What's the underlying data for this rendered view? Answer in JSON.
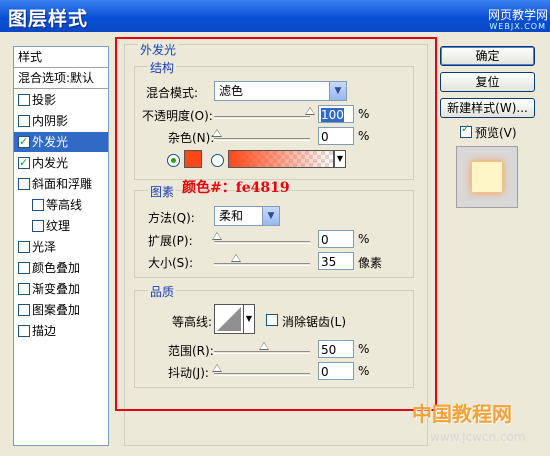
{
  "window": {
    "title": "图层样式",
    "watermark_top": "网页教学网",
    "watermark_url": "WEBJX.COM"
  },
  "styles_panel": {
    "header": "样式",
    "items": [
      {
        "label": "混合选项:默认",
        "checkbox": false,
        "checked": false,
        "selected": false
      },
      {
        "label": "投影",
        "checkbox": true,
        "checked": false,
        "selected": false
      },
      {
        "label": "内阴影",
        "checkbox": true,
        "checked": false,
        "selected": false
      },
      {
        "label": "外发光",
        "checkbox": true,
        "checked": true,
        "selected": true
      },
      {
        "label": "内发光",
        "checkbox": true,
        "checked": true,
        "selected": false
      },
      {
        "label": "斜面和浮雕",
        "checkbox": true,
        "checked": false,
        "selected": false
      },
      {
        "label": "等高线",
        "checkbox": true,
        "checked": false,
        "selected": false
      },
      {
        "label": "纹理",
        "checkbox": true,
        "checked": false,
        "selected": false
      },
      {
        "label": "光泽",
        "checkbox": true,
        "checked": false,
        "selected": false
      },
      {
        "label": "颜色叠加",
        "checkbox": true,
        "checked": false,
        "selected": false
      },
      {
        "label": "渐变叠加",
        "checkbox": true,
        "checked": false,
        "selected": false
      },
      {
        "label": "图案叠加",
        "checkbox": true,
        "checked": false,
        "selected": false
      },
      {
        "label": "描边",
        "checkbox": true,
        "checked": false,
        "selected": false
      }
    ]
  },
  "outer_glow": {
    "title": "外发光",
    "structure": {
      "title": "结构",
      "blend_mode_label": "混合模式:",
      "blend_mode_value": "滤色",
      "opacity_label": "不透明度(O):",
      "opacity_value": "100",
      "opacity_unit": "%",
      "noise_label": "杂色(N):",
      "noise_value": "0",
      "noise_unit": "%",
      "glow_color": "#fe4819"
    },
    "elements": {
      "title": "图素",
      "method_label": "方法(Q):",
      "method_value": "柔和",
      "spread_label": "扩展(P):",
      "spread_value": "0",
      "spread_unit": "%",
      "size_label": "大小(S):",
      "size_value": "35",
      "size_unit": "像素"
    },
    "quality": {
      "title": "品质",
      "contour_label": "等高线:",
      "antialias_label": "消除锯齿(L)",
      "range_label": "范围(R):",
      "range_value": "50",
      "range_unit": "%",
      "jitter_label": "抖动(J):",
      "jitter_value": "0",
      "jitter_unit": "%"
    }
  },
  "annotation": "颜色#：fe4819",
  "buttons": {
    "ok": "确定",
    "reset": "复位",
    "new_style": "新建样式(W)...",
    "preview": "预览(V)"
  },
  "footer_watermark": "中国教程网",
  "footer_url": "www.jcwcn.com"
}
